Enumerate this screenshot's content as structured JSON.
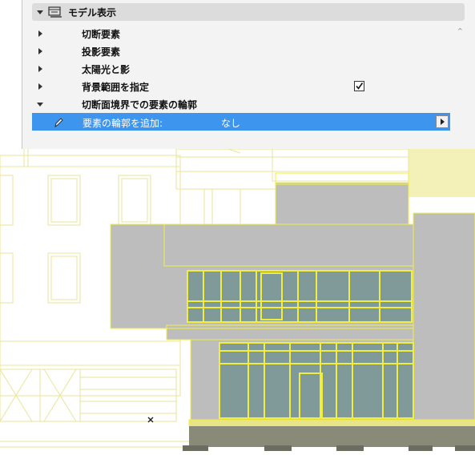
{
  "panel": {
    "header": {
      "title": "モデル表示",
      "icon": "model-display-icon"
    },
    "rows": [
      {
        "label": "切断要素",
        "expanded": false
      },
      {
        "label": "投影要素",
        "expanded": false
      },
      {
        "label": "太陽光と影",
        "expanded": false
      },
      {
        "label": "背景範囲を指定",
        "expanded": false,
        "checked": true
      },
      {
        "label": "切断面境界での要素の輪郭",
        "expanded": true
      }
    ],
    "selected_row": {
      "label": "要素の輪郭を追加:",
      "value": "なし",
      "icon": "pen-icon"
    }
  },
  "colors": {
    "accent": "#3d95ee",
    "wall_fill": "#bdbdbd",
    "glass": "#7f9a98",
    "outline": "#f2ee3e",
    "ground": "#8a8a78"
  }
}
